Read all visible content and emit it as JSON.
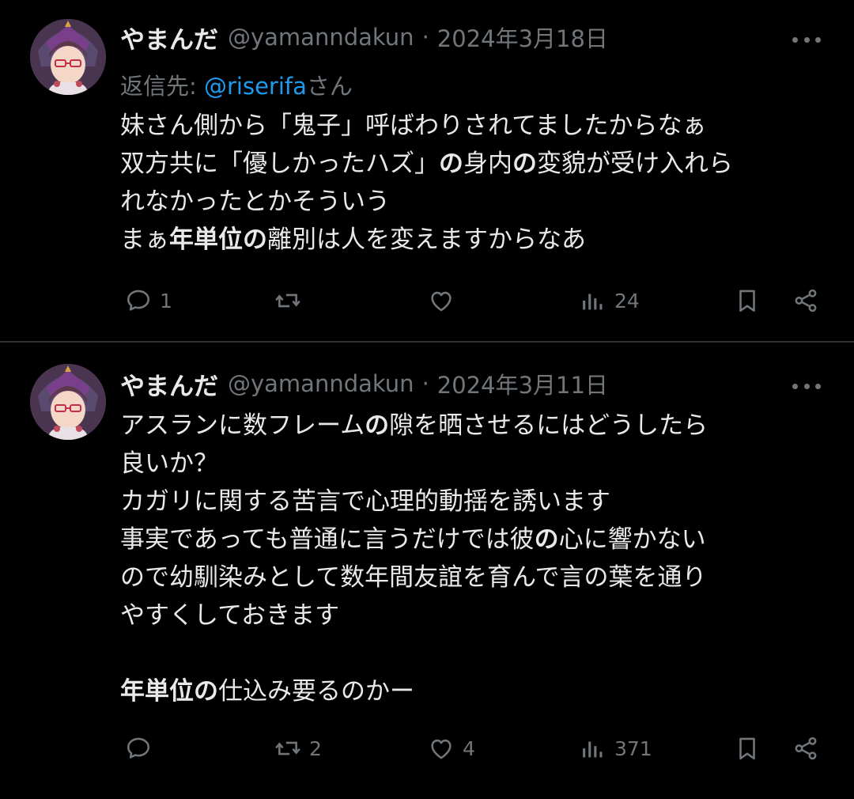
{
  "tweets": [
    {
      "name": "やまんだ",
      "handle": "@yamanndakun",
      "separator": "·",
      "date": "2024年3月18日",
      "reply_prefix": "返信先: ",
      "reply_mention": "@riserifa",
      "reply_suffix": "さん",
      "lines": [
        [
          {
            "t": "妹さん側から「鬼子」呼ばわりされてましたからなぁ",
            "b": false
          }
        ],
        [
          {
            "t": "双方共に「優しかったハズ」",
            "b": false
          },
          {
            "t": "の",
            "b": true
          },
          {
            "t": "身内",
            "b": false
          },
          {
            "t": "の",
            "b": true
          },
          {
            "t": "変貌が受け入れら",
            "b": false
          }
        ],
        [
          {
            "t": "れなかったとかそういう",
            "b": false
          }
        ],
        [
          {
            "t": "まぁ",
            "b": false
          },
          {
            "t": "年単位の",
            "b": true
          },
          {
            "t": "離別は人を変えますからなあ",
            "b": false
          }
        ]
      ],
      "actions": {
        "replies": "1",
        "reposts": "",
        "likes": "",
        "views": "24"
      }
    },
    {
      "name": "やまんだ",
      "handle": "@yamanndakun",
      "separator": "·",
      "date": "2024年3月11日",
      "lines": [
        [
          {
            "t": "アスランに数フレーム",
            "b": false
          },
          {
            "t": "の",
            "b": true
          },
          {
            "t": "隙を晒させるにはどうしたら",
            "b": false
          }
        ],
        [
          {
            "t": "良いか？",
            "b": false
          }
        ],
        [
          {
            "t": "カガリに関する苦言で心理的動揺を誘います",
            "b": false
          }
        ],
        [
          {
            "t": "事実であっても普通に言うだけでは彼",
            "b": false
          },
          {
            "t": "の",
            "b": true
          },
          {
            "t": "心に響かない",
            "b": false
          }
        ],
        [
          {
            "t": "ので幼馴染みとして数年間友誼を育んで言の葉を通り",
            "b": false
          }
        ],
        [
          {
            "t": "やすくしておきます",
            "b": false
          }
        ],
        [],
        [
          {
            "t": "年単位の",
            "b": true
          },
          {
            "t": "仕込み要るのかー",
            "b": false
          }
        ]
      ],
      "actions": {
        "replies": "",
        "reposts": "2",
        "likes": "4",
        "views": "371"
      }
    }
  ],
  "icons": {
    "reply": "comment-bubble-icon",
    "repost": "repost-arrows-icon",
    "like": "heart-icon",
    "views": "bar-chart-icon",
    "bookmark": "bookmark-icon",
    "share": "share-icon",
    "more": "more-dots-icon"
  },
  "colors": {
    "background": "#000000",
    "text": "#e7e9ea",
    "secondary": "#71767b",
    "link": "#1d9bf0",
    "divider": "#2f3336"
  }
}
